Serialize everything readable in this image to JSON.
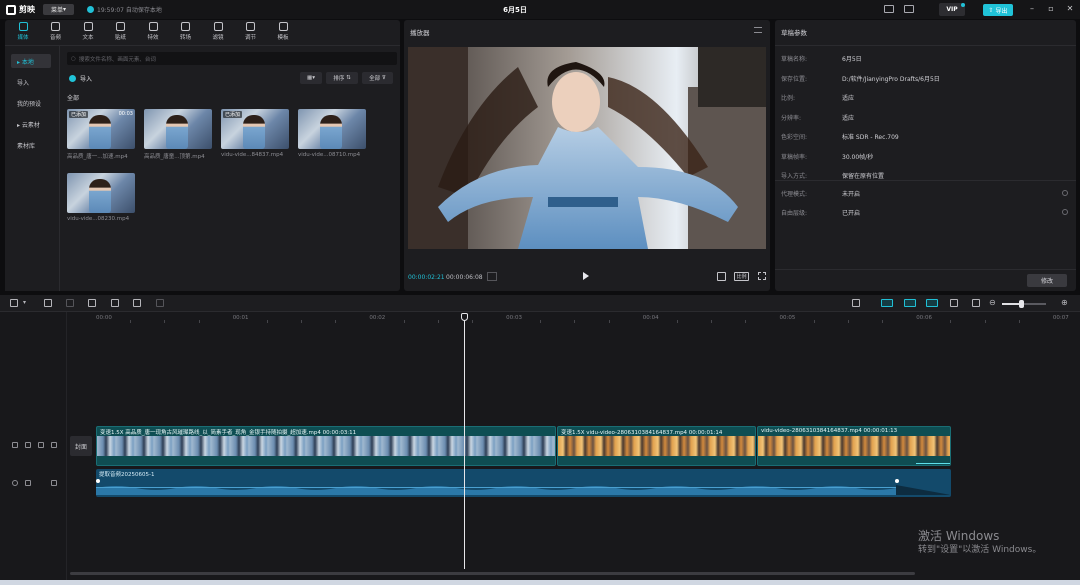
{
  "titlebar": {
    "app_name": "剪映",
    "menu_label": "菜单",
    "save_status": "19:59:07 自动保存本地",
    "project_title": "6月5日",
    "vip_label": "VIP",
    "export_label": "导出"
  },
  "media_tools": [
    {
      "label": "媒体",
      "icon": "media-icon",
      "active": true
    },
    {
      "label": "音频",
      "icon": "audio-icon"
    },
    {
      "label": "文本",
      "icon": "text-icon"
    },
    {
      "label": "贴纸",
      "icon": "sticker-icon"
    },
    {
      "label": "特效",
      "icon": "effects-icon"
    },
    {
      "label": "转场",
      "icon": "transition-icon"
    },
    {
      "label": "滤镜",
      "icon": "filter-icon"
    },
    {
      "label": "调节",
      "icon": "adjust-icon"
    },
    {
      "label": "模板",
      "icon": "template-icon"
    }
  ],
  "media_nav": [
    {
      "label": "▸ 本地",
      "active": true
    },
    {
      "label": "导入"
    },
    {
      "label": "我的预设"
    },
    {
      "label": "▸ 云素材"
    },
    {
      "label": "素材库"
    }
  ],
  "media": {
    "search_placeholder": "搜索文件名称、画面元素、台词",
    "import_label": "导入",
    "sort_label": "排序",
    "filter_label": "全部",
    "all_label": "全部",
    "items": [
      {
        "name": "高品质_唐一...加速.mp4",
        "badge": "已添加",
        "duration": "00:03"
      },
      {
        "name": "高品质_唐童...顶第.mp4",
        "badge": "",
        "duration": ""
      },
      {
        "name": "vidu-vide...84837.mp4",
        "badge": "已添加",
        "duration": ""
      },
      {
        "name": "vidu-vide...08710.mp4",
        "badge": "",
        "duration": ""
      },
      {
        "name": "vidu-vide...08230.mp4",
        "badge": "",
        "duration": ""
      }
    ]
  },
  "player": {
    "title": "播放器",
    "current_time": "00:00:02:21",
    "total_time": "00:00:06:08",
    "ratio_label": "比例"
  },
  "draft": {
    "title": "草稿参数",
    "rows": [
      {
        "k": "草稿名称:",
        "v": "6月5日"
      },
      {
        "k": "保存位置:",
        "v": "D:/软件/JianyingPro Drafts/6月5日"
      },
      {
        "k": "比例:",
        "v": "适应"
      },
      {
        "k": "分辨率:",
        "v": "适应"
      },
      {
        "k": "色彩空间:",
        "v": "标准 SDR - Rec.709"
      },
      {
        "k": "草稿帧率:",
        "v": "30.00帧/秒"
      },
      {
        "k": "导入方式:",
        "v": "保留在原有位置"
      }
    ],
    "rows2": [
      {
        "k": "代理模式:",
        "v": "未开启"
      },
      {
        "k": "自由层级:",
        "v": "已开启"
      }
    ],
    "modify_label": "修改"
  },
  "timeline": {
    "ticks": [
      "00:00",
      "00:01",
      "00:02",
      "00:03",
      "00:04",
      "00:05",
      "00:06",
      "00:07"
    ],
    "cover_label": "封面",
    "video_clips": [
      {
        "label": "变速1.5X  高品质_唐一现角古风璀璨路线_以_简素手者_现角_金银手持随拍摄_超加速.mp4  00:00:03:11",
        "theme": "blue"
      },
      {
        "label": "变速1.5X  vidu-video-2806310384164837.mp4  00:00:01:14",
        "theme": "sunset"
      },
      {
        "label": "vidu-video-2806310384164837.mp4  00:00:01:13",
        "theme": "sunset"
      }
    ],
    "audio_clip_label": "提取音频20250605-1"
  },
  "watermark": {
    "line1": "激活 Windows",
    "line2": "转到\"设置\"以激活 Windows。"
  }
}
